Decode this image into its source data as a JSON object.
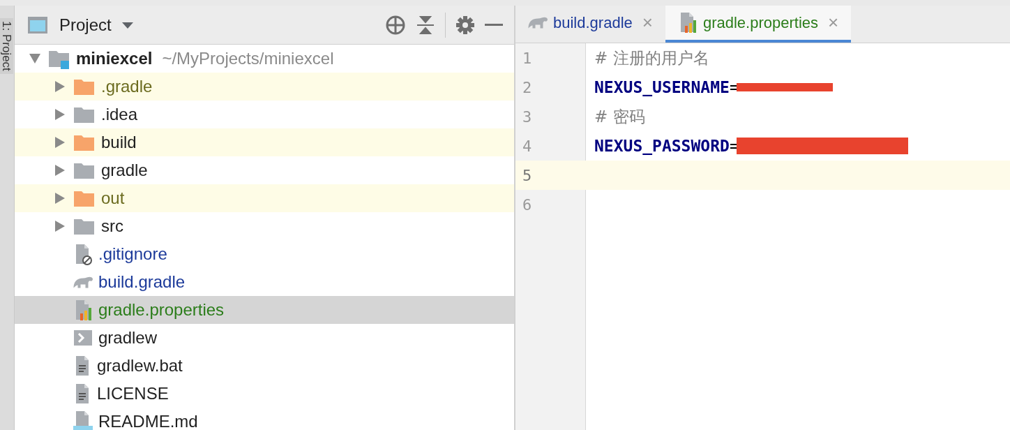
{
  "side_strip": {
    "label": "1: Project"
  },
  "project_panel": {
    "title": "Project",
    "tree": [
      {
        "name": "miniexcel",
        "path": "~/MyProjects/miniexcel",
        "kind": "module",
        "expanded": true,
        "children": [
          {
            "name": ".gradle",
            "kind": "folder-excluded",
            "expanded": false,
            "color": "#6b6b1f",
            "highlighted": true,
            "selected": false
          },
          {
            "name": ".idea",
            "kind": "folder",
            "expanded": false,
            "color": "#1f1f1f",
            "highlighted": false,
            "selected": false
          },
          {
            "name": "build",
            "kind": "folder-excluded",
            "expanded": false,
            "color": "#1f1f1f",
            "highlighted": true,
            "selected": false
          },
          {
            "name": "gradle",
            "kind": "folder",
            "expanded": false,
            "color": "#1f1f1f",
            "highlighted": false,
            "selected": false
          },
          {
            "name": "out",
            "kind": "folder-excluded",
            "expanded": false,
            "color": "#6b6b1f",
            "highlighted": true,
            "selected": false
          },
          {
            "name": "src",
            "kind": "folder",
            "expanded": false,
            "color": "#1f1f1f",
            "highlighted": false,
            "selected": false
          },
          {
            "name": ".gitignore",
            "kind": "ignore",
            "color": "#1c3a9a",
            "highlighted": false,
            "selected": false
          },
          {
            "name": "build.gradle",
            "kind": "gradle",
            "color": "#1c3a9a",
            "highlighted": false,
            "selected": false
          },
          {
            "name": "gradle.properties",
            "kind": "properties",
            "color": "#2b7d1a",
            "highlighted": false,
            "selected": true
          },
          {
            "name": "gradlew",
            "kind": "script",
            "color": "#1f1f1f",
            "highlighted": false,
            "selected": false
          },
          {
            "name": "gradlew.bat",
            "kind": "text",
            "color": "#1f1f1f",
            "highlighted": false,
            "selected": false
          },
          {
            "name": "LICENSE",
            "kind": "text",
            "color": "#1f1f1f",
            "highlighted": false,
            "selected": false
          },
          {
            "name": "README.md",
            "kind": "markdown",
            "color": "#1f1f1f",
            "highlighted": false,
            "selected": false
          }
        ]
      }
    ]
  },
  "editor": {
    "tabs": [
      {
        "label": "build.gradle",
        "kind": "gradle",
        "color": "#1c3a9a",
        "close": "×",
        "selected": false
      },
      {
        "label": "gradle.properties",
        "kind": "properties",
        "color": "#2b7d1a",
        "close": "×",
        "selected": true
      }
    ],
    "lines": [
      {
        "number": "1",
        "kind": "comment",
        "text": "# 注册的用户名",
        "current": false
      },
      {
        "number": "2",
        "kind": "property",
        "key": "NEXUS_USERNAME",
        "separator": "=",
        "redacted": true,
        "current": false
      },
      {
        "number": "3",
        "kind": "comment",
        "text": "# 密码",
        "current": false
      },
      {
        "number": "4",
        "kind": "property",
        "key": "NEXUS_PASSWORD",
        "separator": "=",
        "redacted": true,
        "current": false
      },
      {
        "number": "5",
        "kind": "empty",
        "current": true
      },
      {
        "number": "6",
        "kind": "empty",
        "current": false
      }
    ]
  }
}
